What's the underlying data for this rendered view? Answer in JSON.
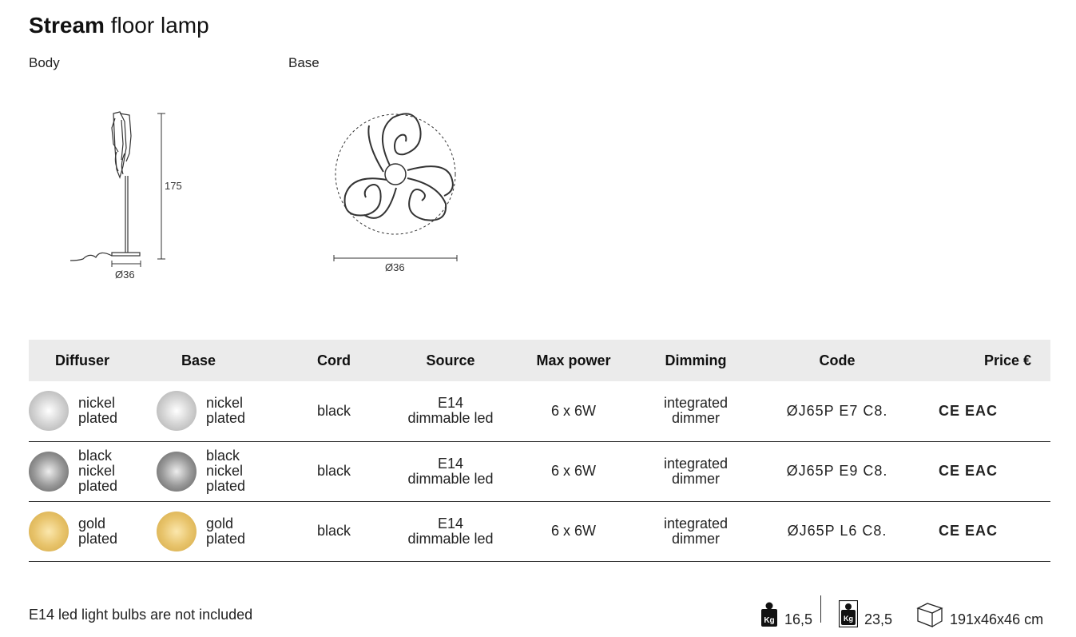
{
  "title": {
    "bold": "Stream",
    "light": "floor lamp"
  },
  "drawings": {
    "body": {
      "label": "Body",
      "height": "175",
      "diameter": "Ø36"
    },
    "base": {
      "label": "Base",
      "diameter": "Ø36"
    }
  },
  "table": {
    "headers": {
      "diffuser": "Diffuser",
      "base": "Base",
      "cord": "Cord",
      "source": "Source",
      "max_power": "Max power",
      "dimming": "Dimming",
      "code": "Code",
      "price": "Price €"
    },
    "rows": [
      {
        "diffuser": [
          "nickel",
          "plated"
        ],
        "base": [
          "nickel",
          "plated"
        ],
        "cord": "black",
        "source": [
          "E14",
          "dimmable led"
        ],
        "max_power": "6 x 6W",
        "dimming": [
          "integrated",
          "dimmer"
        ],
        "code": "ØJ65P E7 C8.",
        "certifications": "CE EAC",
        "price": "",
        "swatch_color": "#bfbfbf"
      },
      {
        "diffuser": [
          "black",
          "nickel",
          "plated"
        ],
        "base": [
          "black",
          "nickel",
          "plated"
        ],
        "cord": "black",
        "source": [
          "E14",
          "dimmable led"
        ],
        "max_power": "6 x 6W",
        "dimming": [
          "integrated",
          "dimmer"
        ],
        "code": "ØJ65P E9 C8.",
        "certifications": "CE EAC",
        "price": "",
        "swatch_color": "#8e8e8e"
      },
      {
        "diffuser": [
          "gold",
          "plated"
        ],
        "base": [
          "gold",
          "plated"
        ],
        "cord": "black",
        "source": [
          "E14",
          "dimmable led"
        ],
        "max_power": "6 x 6W",
        "dimming": [
          "integrated",
          "dimmer"
        ],
        "code": "ØJ65P L6 C8.",
        "certifications": "CE EAC",
        "price": "",
        "swatch_color": "#e3bd5c"
      }
    ]
  },
  "footer": {
    "note": "E14 led light bulbs are not included",
    "net_weight": "16,5",
    "gross_weight": "23,5",
    "package_size": "191x46x46 cm",
    "weight_icon_text": "Kg"
  }
}
